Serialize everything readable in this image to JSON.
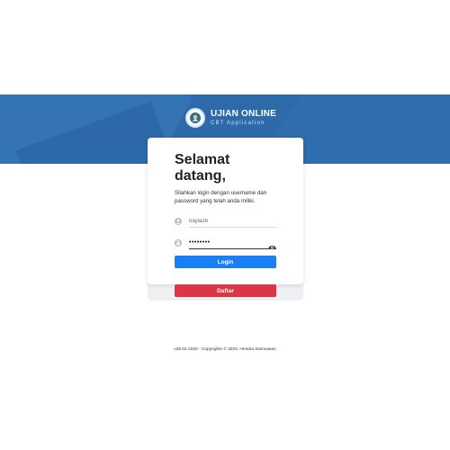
{
  "brand": {
    "title": "UJIAN ONLINE",
    "subtitle": "CBT Application",
    "logo_icon": "tut-wuri-handayani-logo-icon"
  },
  "login": {
    "heading": "Selamat datang,",
    "description": "Silahkan login dengan username dan password yang telah anda miliki.",
    "username_value": "nayla26",
    "password_value": "••••••••",
    "login_label": "Login",
    "register_label": "Daftar"
  },
  "footer": {
    "text": "v28.02.2020 - Copyrights © 2020, Hendra Darmawan"
  },
  "colors": {
    "banner": "#2d6aaa",
    "login_button": "#1a7ef5",
    "register_button": "#dc3545"
  }
}
